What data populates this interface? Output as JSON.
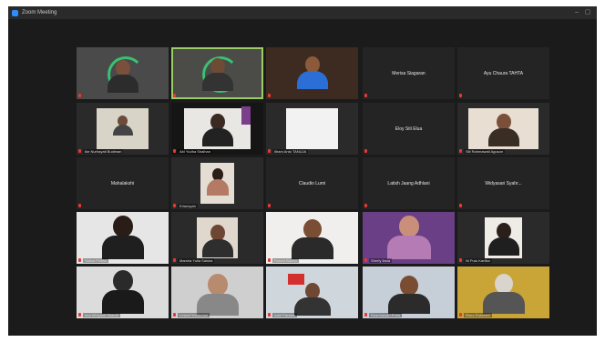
{
  "window": {
    "title": "Zoom Meeting"
  },
  "colors": {
    "active_speaker_border": "#9ccc65",
    "muted_mic": "#e53935",
    "tile_bg": "#242424"
  },
  "participants": [
    {
      "name": "",
      "type": "video"
    },
    {
      "name": "",
      "type": "video"
    },
    {
      "name": "",
      "type": "video"
    },
    {
      "name": "Merisa Siagaran",
      "type": "name"
    },
    {
      "name": "Ayu Chaura TAHTA",
      "type": "name"
    },
    {
      "name": "Ike Nurhayati Budiman",
      "type": "video"
    },
    {
      "name": "Abi Yudha Shalhan",
      "type": "video"
    },
    {
      "name": "Ilham Anto TANUJA",
      "type": "video"
    },
    {
      "name": "Eloy Siti Elua",
      "type": "name"
    },
    {
      "name": "Siti Rahmawati Aguson",
      "type": "video"
    },
    {
      "name": "Mahalakshi",
      "type": "name"
    },
    {
      "name": "Eriansyah",
      "type": "video"
    },
    {
      "name": "Claudio Lumi",
      "type": "name"
    },
    {
      "name": "Latish Jaang Adhlani",
      "type": "name"
    },
    {
      "name": "Widyasari Syahr...",
      "type": "name"
    },
    {
      "name": "Salina Pratiwi",
      "type": "video"
    },
    {
      "name": "Marsha Yulia Salsha",
      "type": "video"
    },
    {
      "name": "Robert Bianco",
      "type": "video"
    },
    {
      "name": "Sherly Ilana",
      "type": "video"
    },
    {
      "name": "Ni Putu Kartika",
      "type": "video"
    },
    {
      "name": "Ima Widyanti Shandi",
      "type": "video"
    },
    {
      "name": "Lestari Wulandari",
      "type": "video"
    },
    {
      "name": "Adril Paraian",
      "type": "video"
    },
    {
      "name": "Dharmawan Putra",
      "type": "video"
    },
    {
      "name": "Rhea Rahmani",
      "type": "video"
    }
  ]
}
